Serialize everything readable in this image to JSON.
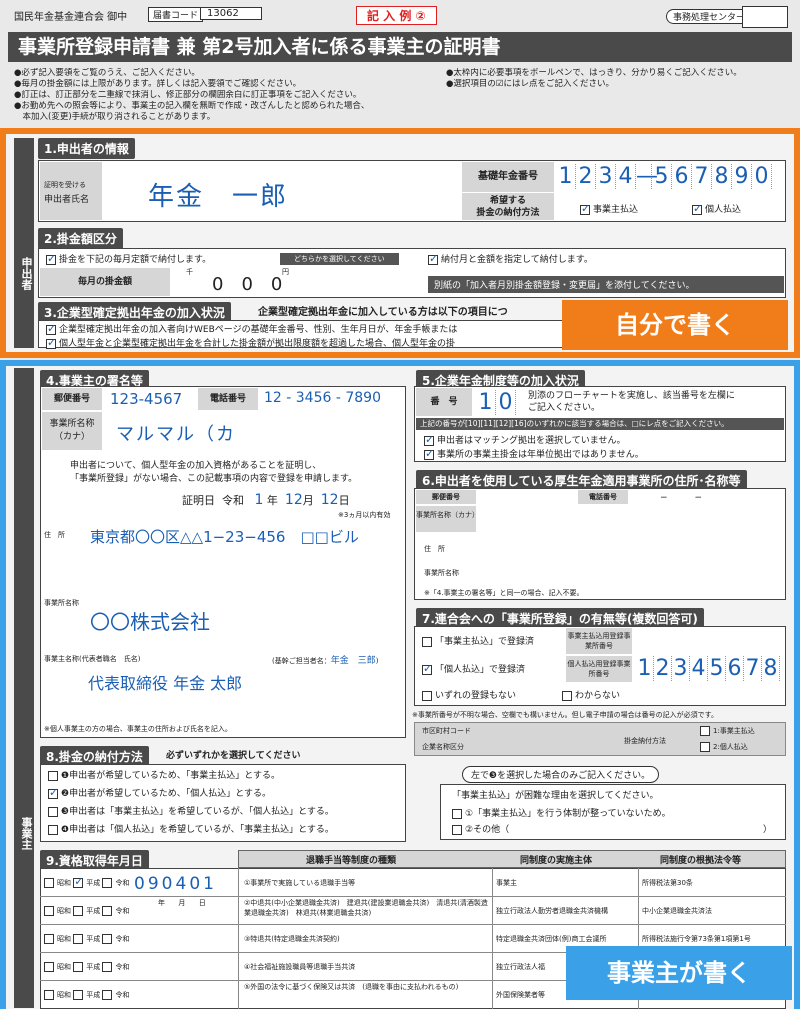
{
  "top": {
    "addressee": "国民年金基金連合会 御中",
    "code_label": "届書コード",
    "code_value": "13062",
    "example_badge": "記 入 例 ②",
    "office_use": "事務処理センター用",
    "title": "事業所登録申請書 兼 第2号加入者に係る事業主の証明書",
    "notes_left": [
      "●必ず記入要領をご覧のうえ、ご記入ください。",
      "●毎月の掛金額には上限があります。詳しくは記入要領でご確認ください。",
      "●訂正は、訂正部分を二重線で抹消し、修正部分の欄囲余白に訂正事項をご記入ください。",
      "●お勤め先への照会等により、事業主の記入欄を無断で作成・改ざんしたと認められた場合、",
      "　本加入(変更)手続が取り消されることがあります。"
    ],
    "notes_right": [
      "●太枠内に必要事項をボールペンで、はっきり、分かり易くご記入ください。",
      "●選択項目の☑にはレ点をご記入ください。"
    ]
  },
  "applicant": {
    "side_label": "申出者",
    "s1_title": "1.申出者の情報",
    "name_label_small": "証明を受ける",
    "name_label": "申出者氏名",
    "name_value": "年金　一郎",
    "pension_label": "基礎年金番号",
    "pension_digits": [
      "1",
      "2",
      "3",
      "4",
      "—",
      "5",
      "6",
      "7",
      "8",
      "9",
      "0"
    ],
    "method_label1": "希望する",
    "method_label2": "掛金の納付方法",
    "method_opt1": "事業主払込",
    "method_opt2": "個人払込",
    "s2_title": "2.掛金額区分",
    "fixed_label": "掛金を下記の毎月定額で納付します。",
    "either_note": "どちらかを選択してください",
    "specify_label": "納付月と金額を指定して納付します。",
    "monthly_label": "毎月の掛金額",
    "thousand": "千",
    "yen": "円",
    "amount_digits": [
      "0",
      "0",
      "0"
    ],
    "attach_note": "別紙の「加入者月別掛金額登録・変更届」を添付してください。",
    "s3_title": "3.企業型確定拠出年金の加入状況",
    "s3_note": "企業型確定拠出年金に加入している方は以下の項目につ",
    "s3_item1": "企業型確定拠出年金の加入者向けWEBページの基礎年金番号、性別、生年月日が、年金手帳または",
    "s3_item2": "個人型年金と企業型確定拠出年金を合計した掛金額が拠出限度額を超過した場合、個人型年金の掛",
    "callout": "自分で書く"
  },
  "employer": {
    "side_label": "事業主",
    "s4_title": "4.事業主の署名等",
    "postal_label": "郵便番号",
    "postal_value": "123-4567",
    "phone_label": "電話番号",
    "phone_value": "12 - 3456 - 7890",
    "kana_label1": "事業所名称",
    "kana_label2": "（カナ）",
    "kana_value": "マルマル（カ",
    "cert_text1": "申出者について、個人型年金の加入資格があることを証明し、",
    "cert_text2": "「事業所登録」がない場合、この記載事項の内容で登録を申請します。",
    "cert_date_label": "証明日",
    "era": "令和",
    "cert_year": "1",
    "year_unit": "年",
    "cert_month": "12",
    "month_unit": "月",
    "cert_day": "12",
    "day_unit": "日",
    "valid_note": "※3ヵ月以内有効",
    "address_label": "住　所",
    "address_value": "東京都〇〇区△△1−23−456　□□ビル",
    "office_name_label": "事業所名称",
    "office_name_value": "〇〇株式会社",
    "rep_label": "事業主名称(代表者職名　氏名)",
    "contact_label": "(基幹ご担当者名：",
    "contact_value": "年金　三郎",
    "contact_close": ")",
    "rep_value": "代表取締役 年金 太郎",
    "sole_note": "※個人事業主の方の場合、事業主の住所および氏名を記入。",
    "s5_title": "5.企業年金制度等の加入状況",
    "s5_number_label": "番　号",
    "s5_digits": [
      "1",
      "0"
    ],
    "s5_desc1": "別添のフローチャートを実施し、該当番号を左欄に",
    "s5_desc2": "ご記入ください。",
    "s5_warn": "上記の番号が[10][11][12][16]のいずれかに該当する場合は、□にレ点をご記入ください。",
    "s5_check1": "申出者はマッチング拠出を選択していません。",
    "s5_check2": "事業所の事業主掛金は年単位拠出ではありません。",
    "s6_title": "6.申出者を使用している厚生年金適用事業所の住所･名称等",
    "s6_postal": "郵便番号",
    "s6_phone": "電話番号",
    "s6_dash": "−　　　−",
    "s6_kana": "事業所名称（カナ）",
    "s6_address": "住　所",
    "s6_name": "事業所名称",
    "s6_note": "※「4.事業主の署名等」と同一の場合、記入不要。",
    "s7_title": "7.連合会への「事業所登録」の有無等(複数回答可)",
    "s7_opt1": "「事業主払込」で登録済",
    "s7_opt1_lbl": "事業主払込用登録事業所番号",
    "s7_opt2": "「個人払込」で登録済",
    "s7_opt2_lbl": "個人払込用登録事業所番号",
    "s7_digits": [
      "1",
      "2",
      "3",
      "4",
      "5",
      "6",
      "7",
      "8"
    ],
    "s7_opt3": "いずれの登録もない",
    "s7_opt4": "わからない",
    "s7_note": "※事業所番号が不明な場合、空欄でも構いません。但し電子申請の場合は番号の記入が必須です。",
    "city_code": "市区町村コード",
    "company_kind": "企業名称区分",
    "pay_method": "掛金納付方法",
    "pay_opt1": "1:事業主払込",
    "pay_opt2": "2:個人払込",
    "s8_title": "8.掛金の納付方法",
    "s8_note": "必ずいずれかを選択してください",
    "s8_item1": "❶申出者が希望しているため、「事業主払込」とする。",
    "s8_item2": "❷申出者が希望しているため、「個人払込」とする。",
    "s8_item3": "❸申出者は「事業主払込」を希望しているが、「個人払込」とする。",
    "s8_item4": "❹申出者は「個人払込」を希望しているが、「事業主払込」とする。",
    "s8_right_title": "左で❸を選択した場合のみご記入ください。",
    "s8_right_q": "「事業主払込」が困難な理由を選択してください。",
    "s8_right_o1": "①「事業主払込」を行う体制が整っていないため。",
    "s8_right_o2": "②その他（",
    "s8_right_o2_close": "）",
    "s9_title": "9.資格取得年月日",
    "s9_h1": "退職手当等制度の種類",
    "s9_h2": "同制度の実施主体",
    "s9_h3": "同制度の根拠法令等",
    "era_labels": [
      "昭和",
      "平成",
      "令和"
    ],
    "s9_date_digits": [
      "0",
      "9",
      "0",
      "4",
      "0",
      "1"
    ],
    "ymd": [
      "年",
      "月",
      "日"
    ],
    "s9_rows": [
      {
        "kind": "①事業所で実施している退職手当等",
        "entity": "事業主",
        "law": "所得税法第30条"
      },
      {
        "kind": "②中退共(中小企業退職金共済)　建退共(建設業退職金共済)　清退共(清酒製造業退職金共済)　林退共(林業退職金共済)",
        "entity": "独立行政法人勤労者退職金共済機構",
        "law": "中小企業退職金共済法"
      },
      {
        "kind": "③特退共(特定退職金共済契約)",
        "entity": "特定退職金共済団体(例)商工会議所",
        "law": "所得税法施行令第73条第1項第1号"
      },
      {
        "kind": "④社会福祉施設職員等退職手当共済",
        "entity": "独立行政法人福",
        "law": ""
      },
      {
        "kind": "⑤外国の法令に基づく保険又は共済　(退職を事由に支払われるもの)",
        "entity": "外国保険業者等",
        "law": ""
      }
    ],
    "callout": "事業主が書く"
  }
}
